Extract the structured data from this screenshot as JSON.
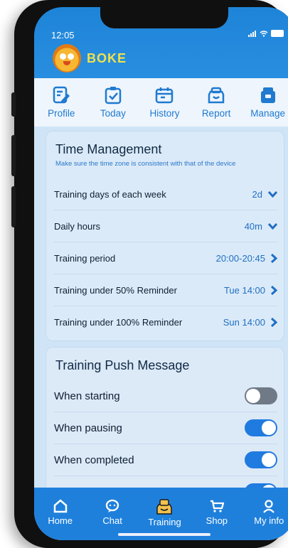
{
  "status_bar": {
    "time": "12:05"
  },
  "app": {
    "brand": "BOKE"
  },
  "top_nav": [
    {
      "label": "Profile",
      "icon": "edit-icon"
    },
    {
      "label": "Today",
      "icon": "clipboard-check-icon"
    },
    {
      "label": "History",
      "icon": "calendar-icon"
    },
    {
      "label": "Report",
      "icon": "report-icon"
    },
    {
      "label": "Manage",
      "icon": "manage-icon"
    }
  ],
  "time_management": {
    "title": "Time Management",
    "subtitle": "Make sure the time zone is consistent with that of the device",
    "rows": [
      {
        "label": "Training days of each week",
        "value": "2d",
        "control": "dropdown"
      },
      {
        "label": "Daily hours",
        "value": "40m",
        "control": "dropdown"
      },
      {
        "label": "Training period",
        "value": "20:00-20:45",
        "control": "arrow"
      },
      {
        "label": "Training under 50% Reminder",
        "value": "Tue 14:00",
        "control": "arrow"
      },
      {
        "label": "Training under 100% Reminder",
        "value": "Sun 14:00",
        "control": "arrow"
      }
    ]
  },
  "push_message": {
    "title": "Training Push Message",
    "rows": [
      {
        "label": "When starting",
        "on": false
      },
      {
        "label": "When pausing",
        "on": true
      },
      {
        "label": "When completed",
        "on": true
      }
    ]
  },
  "tab_bar": [
    {
      "label": "Home",
      "icon": "home-icon",
      "active": false
    },
    {
      "label": "Chat",
      "icon": "chat-icon",
      "active": false
    },
    {
      "label": "Training",
      "icon": "training-icon",
      "active": true
    },
    {
      "label": "Shop",
      "icon": "cart-icon",
      "active": false
    },
    {
      "label": "My info",
      "icon": "user-icon",
      "active": false
    }
  ],
  "colors": {
    "primary": "#1f80dc",
    "accent_text": "#1f6fc4",
    "toggle_off": "#6f7a86"
  }
}
